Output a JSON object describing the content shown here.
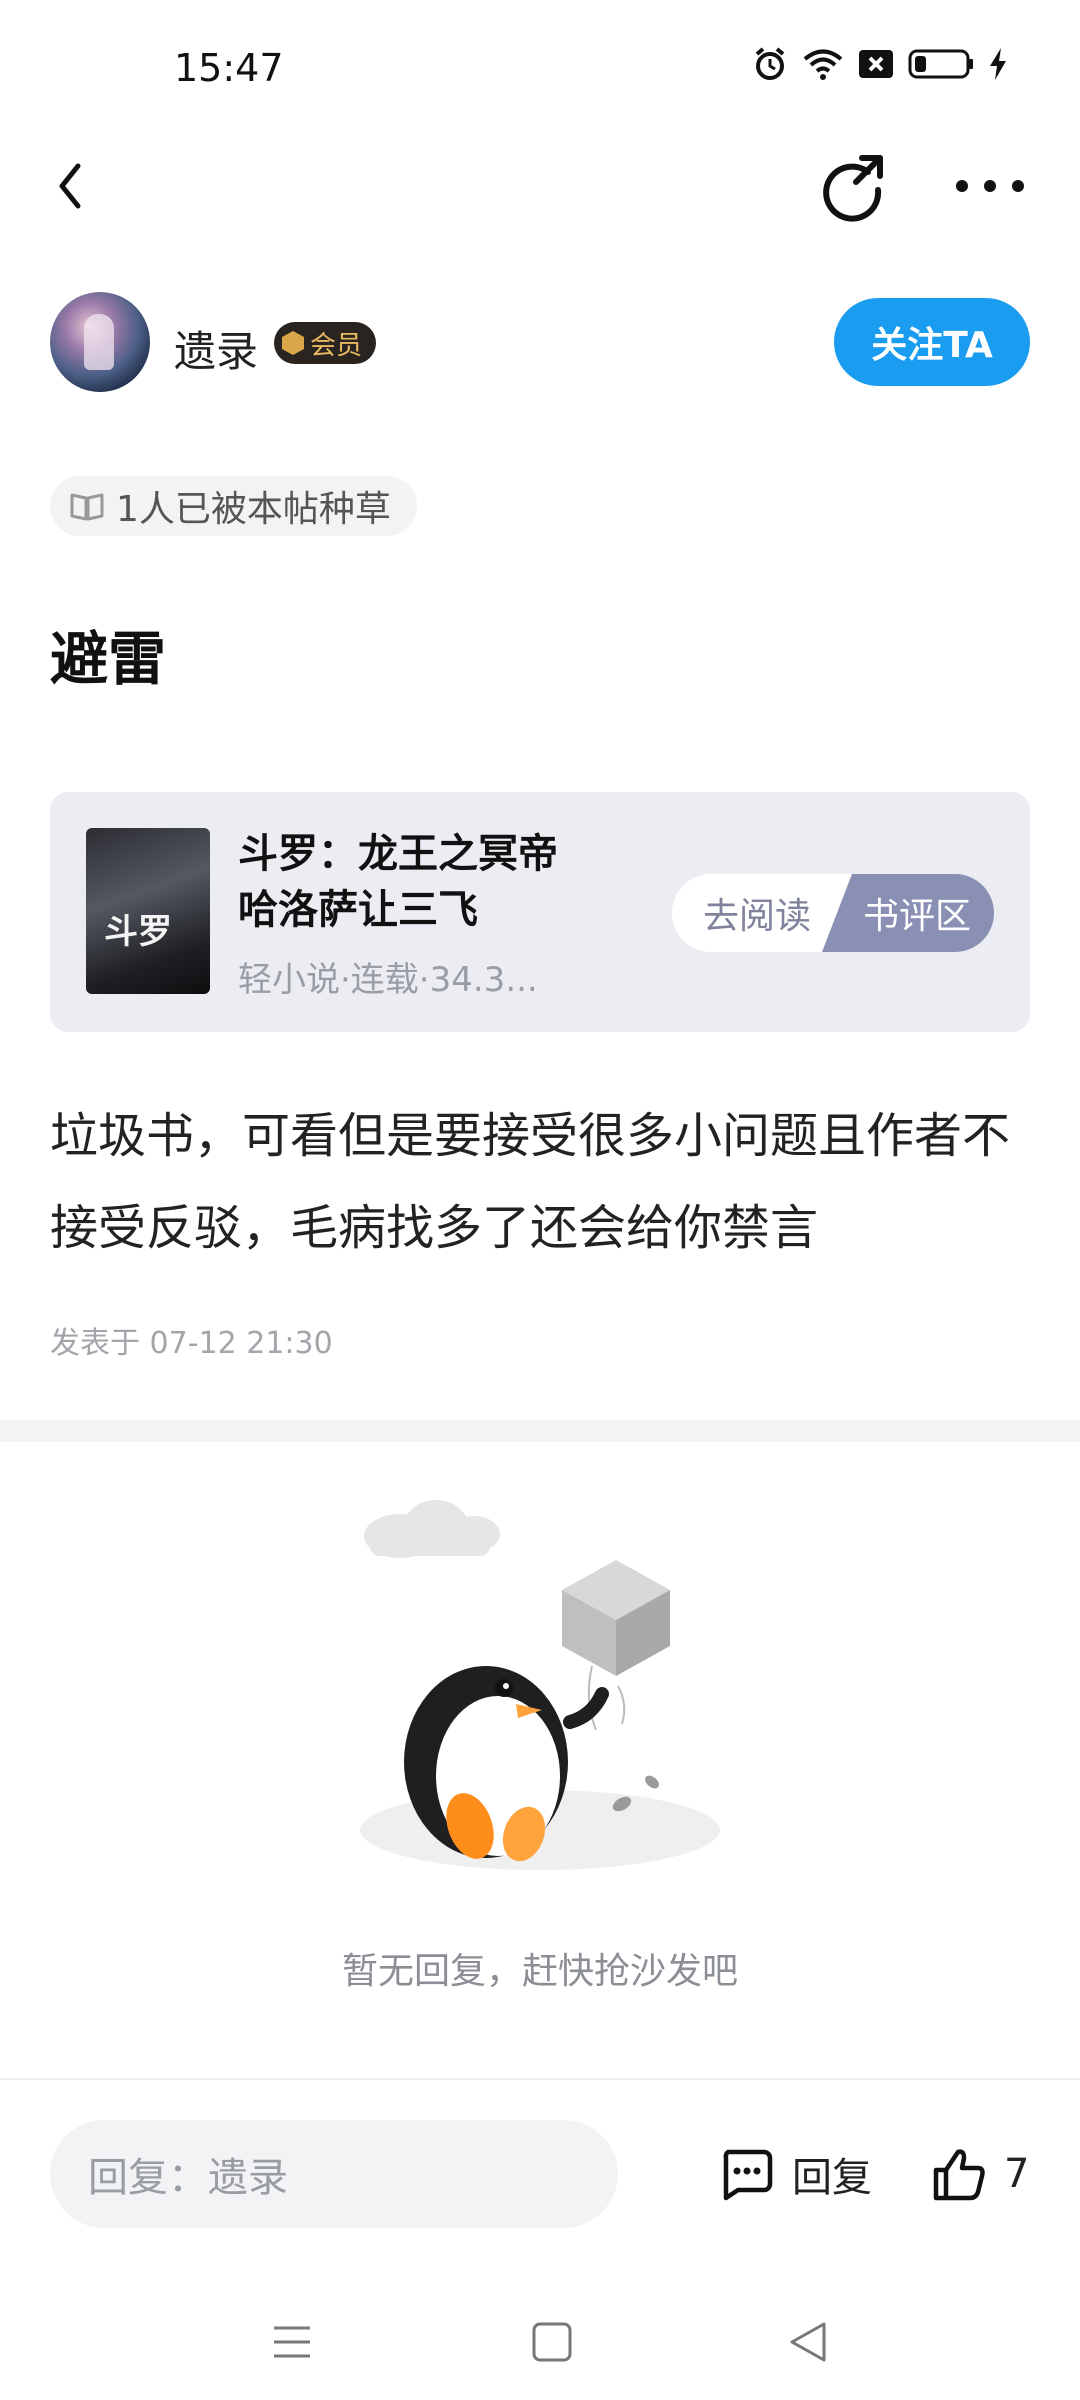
{
  "status_bar": {
    "time": "15:47",
    "icons": [
      "alarm-icon",
      "wifi-icon",
      "sim-off-icon",
      "battery-icon",
      "charging-icon"
    ],
    "battery_level": 0.2
  },
  "nav": {
    "icons": [
      "back-icon",
      "share-icon",
      "more-icon"
    ]
  },
  "author": {
    "name": "遗录",
    "badge": "会员",
    "follow_label": "关注TA"
  },
  "grass_tag": {
    "text": "1人已被本帖种草",
    "icon": "book-icon"
  },
  "post": {
    "title": "避雷",
    "body": "垃圾书，可看但是要接受很多小问题且作者不接受反驳，毛病找多了还会给你禁言",
    "time": "发表于 07-12 21:30"
  },
  "book": {
    "title": "斗罗：龙王之冥帝哈洛萨让三飞",
    "meta": "轻小说·连载·34.3...",
    "cover_text": "斗罗",
    "read_label": "去阅读",
    "review_label": "书评区"
  },
  "empty": {
    "text": "暂无回复，赶快抢沙发吧",
    "illustration": "penguin-with-box"
  },
  "bottom_bar": {
    "reply_placeholder": "回复：遗录",
    "reply_label": "回复",
    "like_count": "7"
  },
  "colors": {
    "accent": "#1a9df0",
    "review_button": "#8a8fb4",
    "card_bg": "#ecedf3"
  }
}
